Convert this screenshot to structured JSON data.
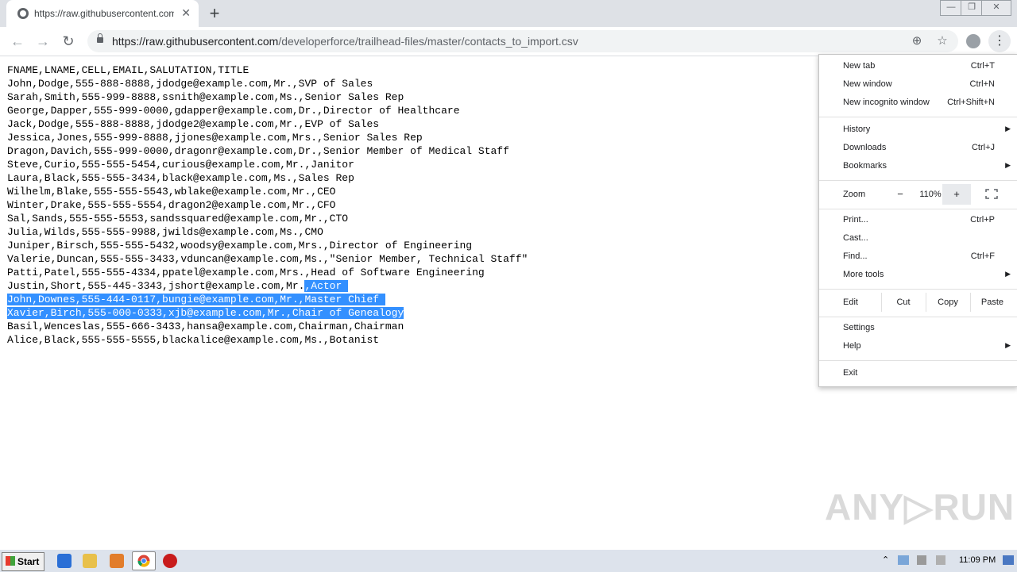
{
  "tab": {
    "title": "https://raw.githubusercontent.com/",
    "close": "✕",
    "new_tab": "+"
  },
  "window_controls": {
    "minimize": "—",
    "maximize": "❐",
    "close": "✕"
  },
  "toolbar": {
    "url_host": "https://raw.githubusercontent.com",
    "url_path": "/developerforce/trailhead-files/master/contacts_to_import.csv",
    "back": "←",
    "forward": "→",
    "reload": "↻",
    "zoom": "⊕",
    "bookmark": "☆",
    "menu": "⋮"
  },
  "content": {
    "lines": [
      "FNAME,LNAME,CELL,EMAIL,SALUTATION,TITLE",
      "John,Dodge,555-888-8888,jdodge@example.com,Mr.,SVP of Sales",
      "Sarah,Smith,555-999-8888,ssnith@example.com,Ms.,Senior Sales Rep",
      "George,Dapper,555-999-0000,gdapper@example.com,Dr.,Director of Healthcare",
      "Jack,Dodge,555-888-8888,jdodge2@example.com,Mr.,EVP of Sales",
      "Jessica,Jones,555-999-8888,jjones@example.com,Mrs.,Senior Sales Rep",
      "Dragon,Davich,555-999-0000,dragonr@example.com,Dr.,Senior Member of Medical Staff",
      "Steve,Curio,555-555-5454,curious@example.com,Mr.,Janitor",
      "Laura,Black,555-555-3434,black@example.com,Ms.,Sales Rep",
      "Wilhelm,Blake,555-555-5543,wblake@example.com,Mr.,CEO",
      "Winter,Drake,555-555-5554,dragon2@example.com,Mr.,CFO",
      "Sal,Sands,555-555-5553,sandssquared@example.com,Mr.,CTO",
      "Julia,Wilds,555-555-9988,jwilds@example.com,Ms.,CMO",
      "Juniper,Birsch,555-555-5432,woodsy@example.com,Mrs.,Director of Engineering",
      "Valerie,Duncan,555-555-3433,vduncan@example.com,Ms.,\"Senior Member, Technical Staff\"",
      "Patti,Patel,555-555-4334,ppatel@example.com,Mrs.,Head of Software Engineering"
    ],
    "sel_line_prefix": "Justin,Short,555-445-3343,jshort@example.com,Mr.",
    "sel_line_selected": ",Actor ",
    "selected_lines": [
      "John,Downes,555-444-0117,bungie@example.com,Mr.,Master Chief ",
      "Xavier,Birch,555-000-0333,xjb@example.com,Mr.,Chair of Genealogy"
    ],
    "tail_lines": [
      "Basil,Wenceslas,555-666-3433,hansa@example.com,Chairman,Chairman",
      "Alice,Black,555-555-5555,blackalice@example.com,Ms.,Botanist"
    ]
  },
  "menu": {
    "new_tab": "New tab",
    "new_tab_sc": "Ctrl+T",
    "new_window": "New window",
    "new_window_sc": "Ctrl+N",
    "incognito": "New incognito window",
    "incognito_sc": "Ctrl+Shift+N",
    "history": "History",
    "downloads": "Downloads",
    "downloads_sc": "Ctrl+J",
    "bookmarks": "Bookmarks",
    "zoom": "Zoom",
    "zoom_minus": "−",
    "zoom_value": "110%",
    "zoom_plus": "+",
    "print": "Print...",
    "print_sc": "Ctrl+P",
    "cast": "Cast...",
    "find": "Find...",
    "find_sc": "Ctrl+F",
    "more_tools": "More tools",
    "edit": "Edit",
    "cut": "Cut",
    "copy": "Copy",
    "paste": "Paste",
    "settings": "Settings",
    "help": "Help",
    "exit": "Exit",
    "arrow": "▶"
  },
  "watermark": "ANY▷RUN",
  "taskbar": {
    "start": "Start",
    "clock": "11:09 PM"
  },
  "colors": {
    "selection": "#3390ff",
    "tab_strip": "#dee1e6",
    "taskbar": "#dde3ec"
  }
}
